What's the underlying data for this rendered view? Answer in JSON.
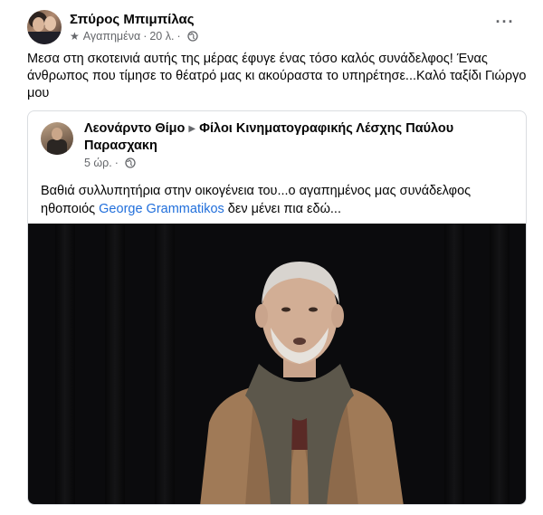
{
  "post": {
    "author": "Σπύρος Μπιμπίλας",
    "audience": "Αγαπημένα",
    "time": "20 λ.",
    "separator": "·",
    "text": "Μεσα στη σκοτεινιά αυτής της μέρας έφυγε ένας τόσο καλός συνάδελφος! Ένας άνθρωπος που τίμησε το θέατρό μας  κι ακούραστα το υπηρέτησε...Καλό ταξίδι Γιώργο μου",
    "more_icon": "more-horizontal-icon",
    "audience_icon": "star-icon",
    "privacy_icon": "globe-icon"
  },
  "shared": {
    "author": "Λεονάρντο Θίμο",
    "group": "Φίλοι Κινηματογραφικής Λέσχης Παύλου Παρασχακη",
    "time": "5 ώρ.",
    "separator": "·",
    "text_before": "Βαθιά συλλυπητήρια στην οικογένεια του...ο αγαπημένος μας συνάδελφος ηθοποιός ",
    "tag": "George Grammatikos",
    "text_after": " δεν μένει πια εδώ...",
    "arrow_icon": "triangle-right-icon",
    "privacy_icon": "globe-icon"
  },
  "colors": {
    "link": "#216fdb",
    "meta": "#65676b",
    "text": "#050505",
    "border": "#dadde1"
  }
}
